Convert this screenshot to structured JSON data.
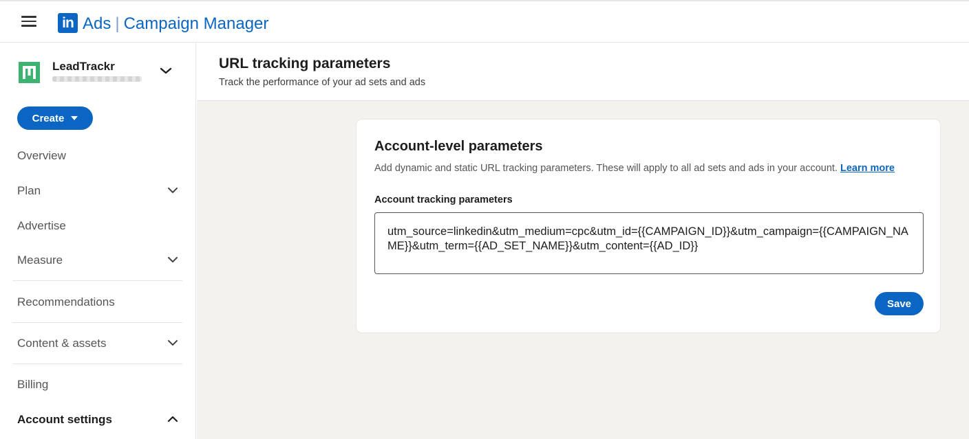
{
  "header": {
    "logo_text": "in",
    "product": "Ads",
    "app_name": "Campaign Manager"
  },
  "sidebar": {
    "account_name": "LeadTrackr",
    "create_label": "Create",
    "items": [
      {
        "label": "Overview",
        "has_chevron": false
      },
      {
        "label": "Plan",
        "has_chevron": true
      },
      {
        "label": "Advertise",
        "has_chevron": false
      },
      {
        "label": "Measure",
        "has_chevron": true
      },
      {
        "label": "Recommendations",
        "has_chevron": false
      },
      {
        "label": "Content & assets",
        "has_chevron": true
      },
      {
        "label": "Billing",
        "has_chevron": false
      },
      {
        "label": "Account settings",
        "has_chevron": true,
        "expanded": true,
        "active": true
      }
    ]
  },
  "page": {
    "title": "URL tracking parameters",
    "subtitle": "Track the performance of your ad sets and ads"
  },
  "card": {
    "title": "Account-level parameters",
    "description": "Add dynamic and static URL tracking parameters. These will apply to all ad sets and ads in your account.",
    "learn_more": "Learn more",
    "field_label": "Account tracking parameters",
    "field_value": "utm_source=linkedin&utm_medium=cpc&utm_id={{CAMPAIGN_ID}}&utm_campaign={{CAMPAIGN_NAME}}&utm_term={{AD_SET_NAME}}&utm_content={{AD_ID}}",
    "save_label": "Save"
  },
  "colors": {
    "accent": "#0a66c2",
    "account_logo": "#3cb371",
    "content_bg": "#f4f2ee"
  }
}
